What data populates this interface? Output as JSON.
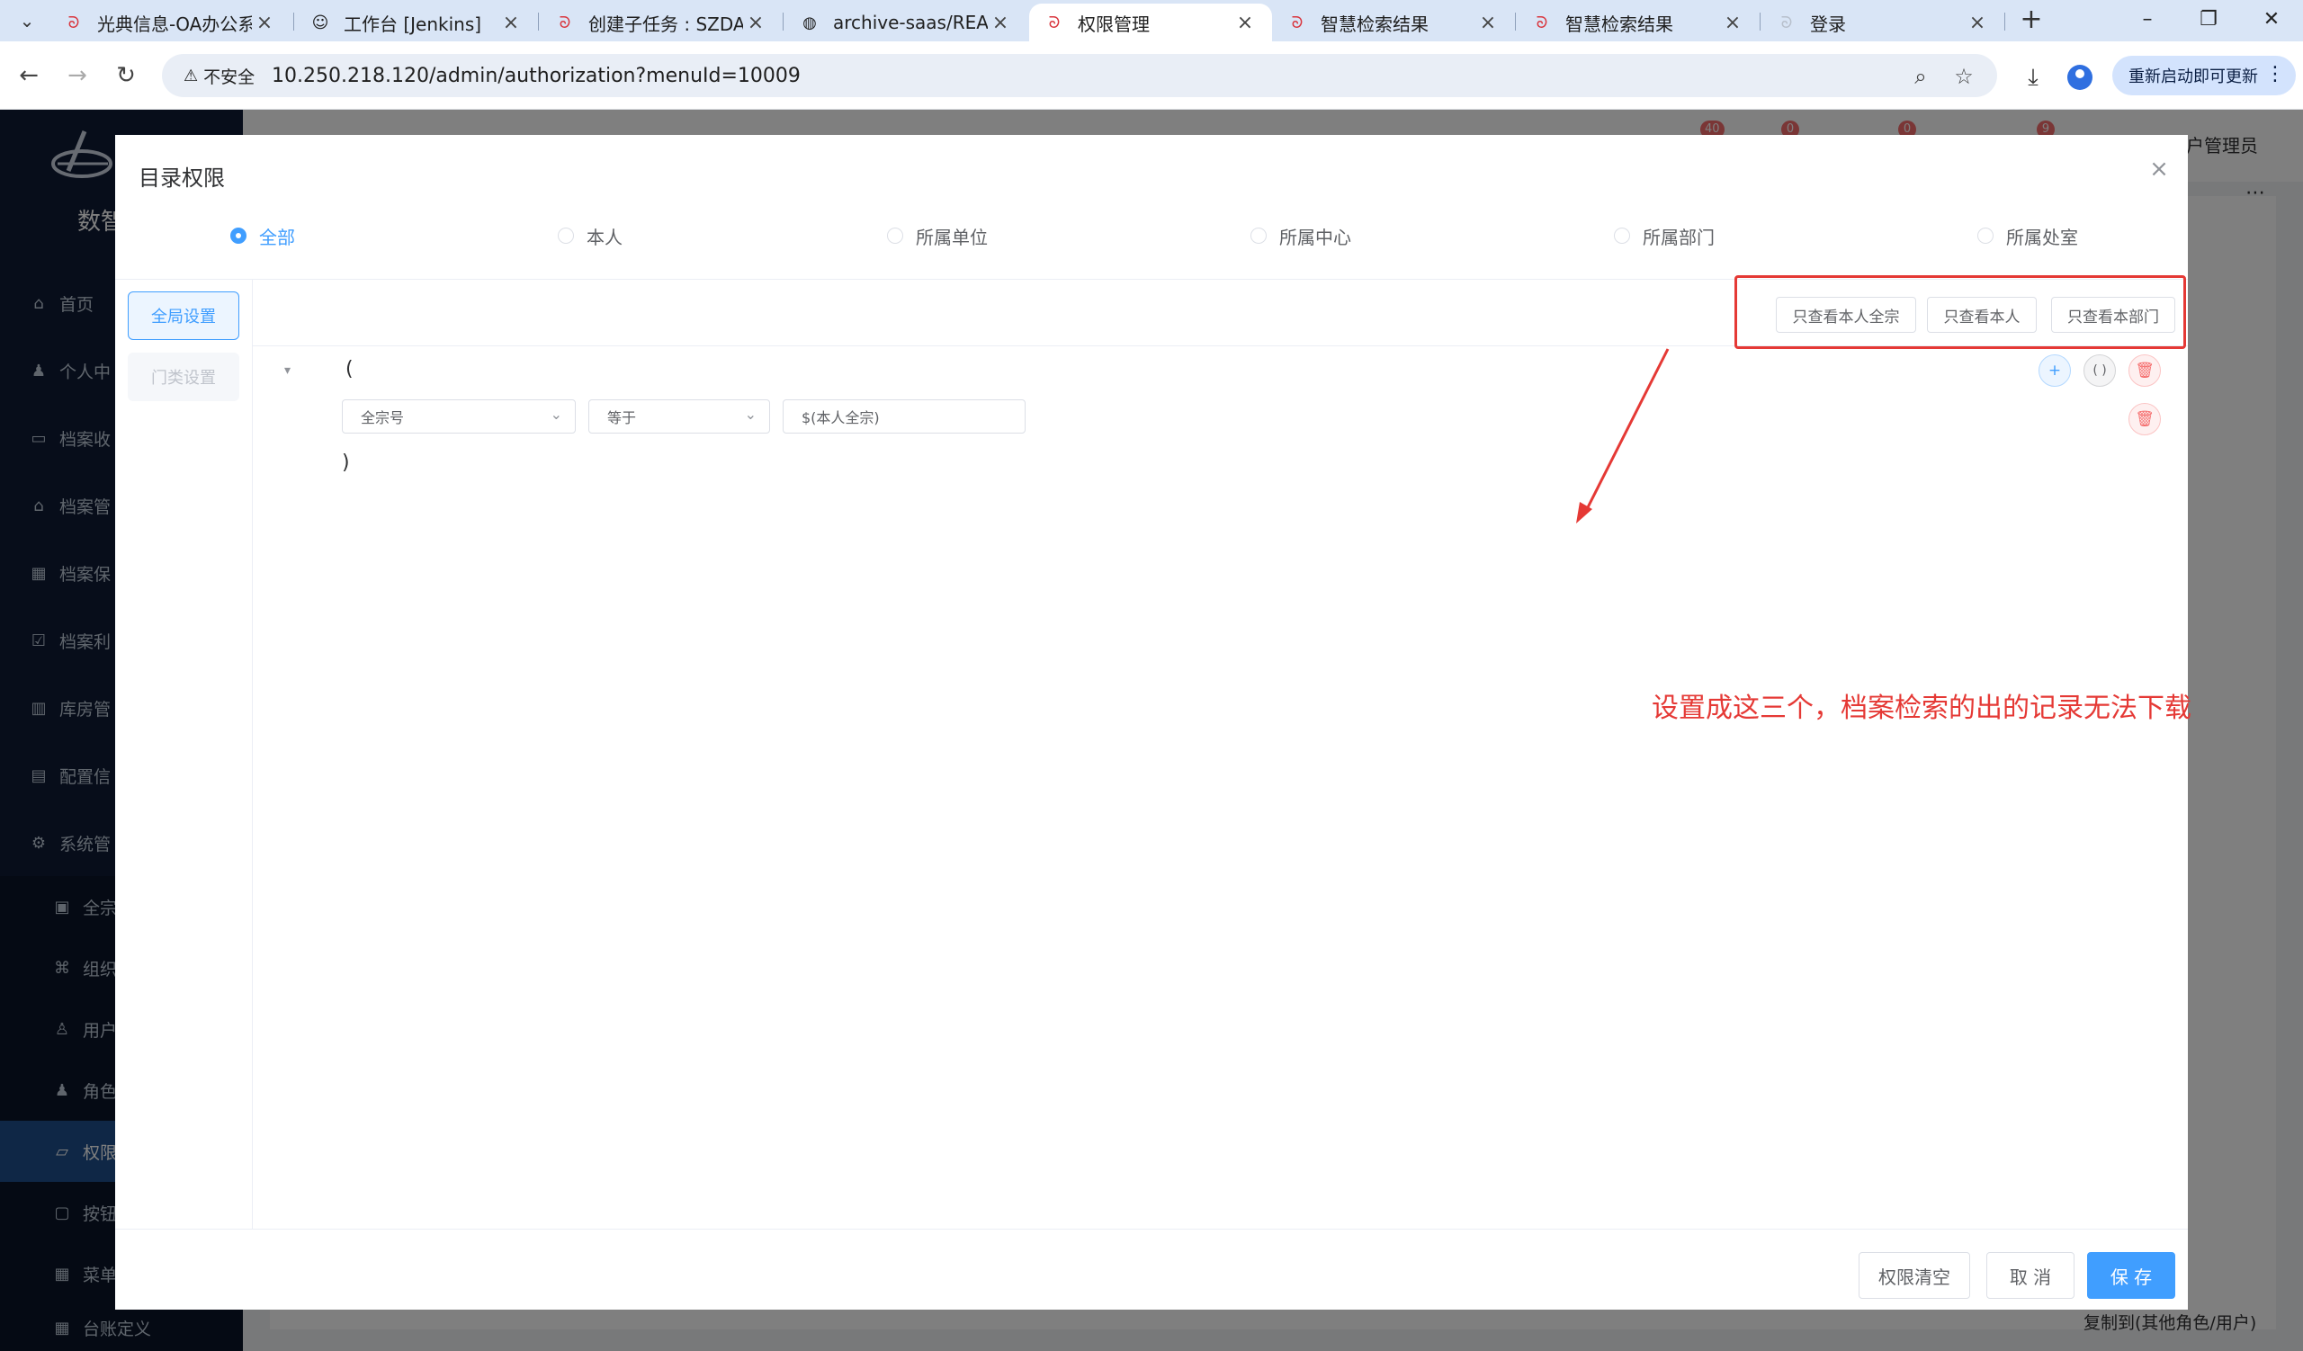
{
  "browser": {
    "tabs": [
      {
        "title": "光典信息-OA办公系统",
        "icon": "app-logo-icon"
      },
      {
        "title": "工作台 [Jenkins]",
        "icon": "jenkins-icon"
      },
      {
        "title": "创建子任务 : SZDA-",
        "icon": "app-logo-icon"
      },
      {
        "title": "archive-saas/READ",
        "icon": "globe-icon"
      },
      {
        "title": "权限管理",
        "icon": "app-logo-icon"
      },
      {
        "title": "智慧检索结果",
        "icon": "app-logo-icon"
      },
      {
        "title": "智慧检索结果",
        "icon": "app-logo-icon"
      },
      {
        "title": "登录",
        "icon": "app-logo-icon"
      }
    ],
    "active_tab": 4,
    "security_label": "不安全",
    "url": "10.250.218.120/admin/authorization?menuId=10009",
    "update_button": "重新启动即可更新"
  },
  "app": {
    "logo_text": "数智",
    "sidebar": [
      {
        "label": "首页",
        "icon": "home-icon"
      },
      {
        "label": "个人中",
        "icon": "user-icon"
      },
      {
        "label": "档案收",
        "icon": "box-icon"
      },
      {
        "label": "档案管",
        "icon": "bank-icon"
      },
      {
        "label": "档案保",
        "icon": "building-icon"
      },
      {
        "label": "档案利",
        "icon": "clipboard-icon"
      },
      {
        "label": "库房管",
        "icon": "warehouse-icon"
      },
      {
        "label": "配置信",
        "icon": "config-icon"
      },
      {
        "label": "系统管",
        "icon": "gear-icon"
      },
      {
        "label": "全宗",
        "icon": "doc-icon"
      },
      {
        "label": "组织",
        "icon": "org-icon"
      },
      {
        "label": "用户",
        "icon": "user-icon"
      },
      {
        "label": "角色",
        "icon": "role-icon"
      },
      {
        "label": "权限",
        "icon": "folder-icon"
      },
      {
        "label": "按钮",
        "icon": "button-icon"
      },
      {
        "label": "菜单",
        "icon": "menu-icon"
      },
      {
        "label": "台账定义",
        "icon": "grid-icon"
      }
    ],
    "active_sidebar": 13,
    "header_user": "户管理员",
    "badges": [
      "40",
      "0",
      "0",
      "9"
    ],
    "bottom_text": "复制到(其他角色/用户)"
  },
  "dialog": {
    "title": "目录权限",
    "scope_options": [
      "全部",
      "本人",
      "所属单位",
      "所属中心",
      "所属部门",
      "所属处室"
    ],
    "scope_selected": 0,
    "left_tabs": [
      "全局设置",
      "门类设置"
    ],
    "quick_buttons": [
      "只查看本人全宗",
      "只查看本人",
      "只查看本部门"
    ],
    "open_paren": "(",
    "close_paren": ")",
    "condition": {
      "field": "全宗号",
      "operator": "等于",
      "value": "$(本人全宗)"
    },
    "annotation": "设置成这三个，档案检索的出的记录无法下载",
    "footer": {
      "clear": "权限清空",
      "cancel": "取 消",
      "save": "保 存"
    },
    "colors": {
      "primary": "#409eff",
      "annotation_red": "#e53935",
      "danger": "#f56c6c"
    }
  }
}
